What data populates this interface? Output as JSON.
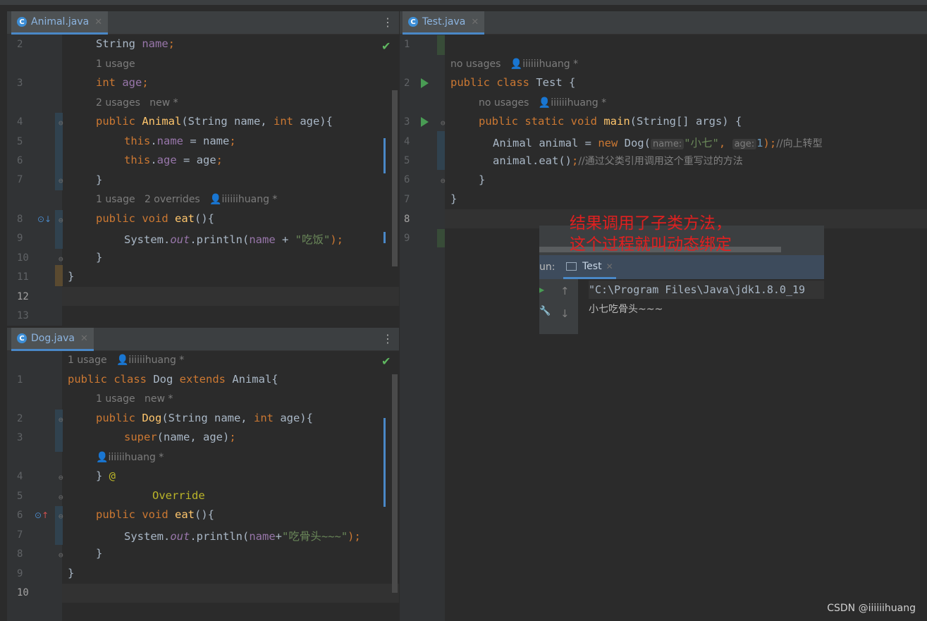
{
  "animal_editor": {
    "tab": "Animal.java",
    "lines": [
      "2",
      "3",
      "4",
      "5",
      "6",
      "7",
      "8",
      "9",
      "10",
      "11",
      "12",
      "13"
    ],
    "l2": [
      "String ",
      "name",
      ";"
    ],
    "hint1": "1 usage",
    "l3": [
      "int ",
      "age",
      ";"
    ],
    "hint2": "2 usages   new *",
    "l4": [
      "public ",
      "Animal",
      "(String name, ",
      "int ",
      "age){"
    ],
    "l5": [
      "this",
      ".",
      "name",
      " = name",
      ";"
    ],
    "l6": [
      "this",
      ".",
      "age",
      " = age",
      ";"
    ],
    "l7": "}",
    "hint3": "1 usage   2 overrides",
    "hint3_author": "iiiiiihuang *",
    "l8": [
      "public ",
      "void ",
      "eat",
      "(){"
    ],
    "l9": [
      "System.",
      "out",
      ".println(",
      "name",
      " + ",
      "\"吃饭\"",
      ");"
    ],
    "l10": "}",
    "l11": "}"
  },
  "dog_editor": {
    "tab": "Dog.java",
    "lines": [
      "1",
      "2",
      "3",
      "4",
      "5",
      "6",
      "7",
      "8",
      "9",
      "10"
    ],
    "hint1": "1 usage",
    "hint1_author": "iiiiiihuang *",
    "l1": [
      "public ",
      "class ",
      "Dog ",
      "extends ",
      "Animal{"
    ],
    "hint2": "1 usage   new *",
    "l2": [
      "public ",
      "Dog",
      "(String name, ",
      "int ",
      "age){"
    ],
    "l3": [
      "super",
      "(name, age)",
      ";"
    ],
    "hint3_author": "iiiiiihuang *",
    "l4": [
      "} ",
      "@"
    ],
    "l5": "Override",
    "l6": [
      "public ",
      "void ",
      "eat",
      "(){"
    ],
    "l7": [
      "System.",
      "out",
      ".println(",
      "name",
      "+",
      "\"吃骨头~~~\"",
      ");"
    ],
    "l8": "}",
    "l9": "}"
  },
  "test_editor": {
    "tab": "Test.java",
    "lines": [
      "1",
      "2",
      "3",
      "4",
      "5",
      "6",
      "7",
      "8",
      "9"
    ],
    "hint1": "no usages",
    "hint1_author": "iiiiiihuang *",
    "l2": [
      "public ",
      "class ",
      "Test {"
    ],
    "hint2": "no usages",
    "hint2_author": "iiiiiihuang *",
    "l3": [
      "public ",
      "static ",
      "void ",
      "main",
      "(String[] args) {"
    ],
    "l4": [
      "Animal animal = ",
      "new ",
      "Dog(",
      "name:",
      "\"小七\"",
      ", ",
      "age:",
      "1",
      ");",
      "//向上转型"
    ],
    "l5": [
      "animal.eat()",
      ";",
      "//通过父类引用调用这个重写过的方法"
    ],
    "l6": "}",
    "l7": "}"
  },
  "run_panel": {
    "label": "un:",
    "tab": "Test",
    "cmd": "\"C:\\Program Files\\Java\\jdk1.8.0_19",
    "output": "小七吃骨头~~~"
  },
  "annotation": "结果调用了子类方法，\n这个过程就叫动态绑定",
  "watermark": "CSDN @iiiiiihuang"
}
